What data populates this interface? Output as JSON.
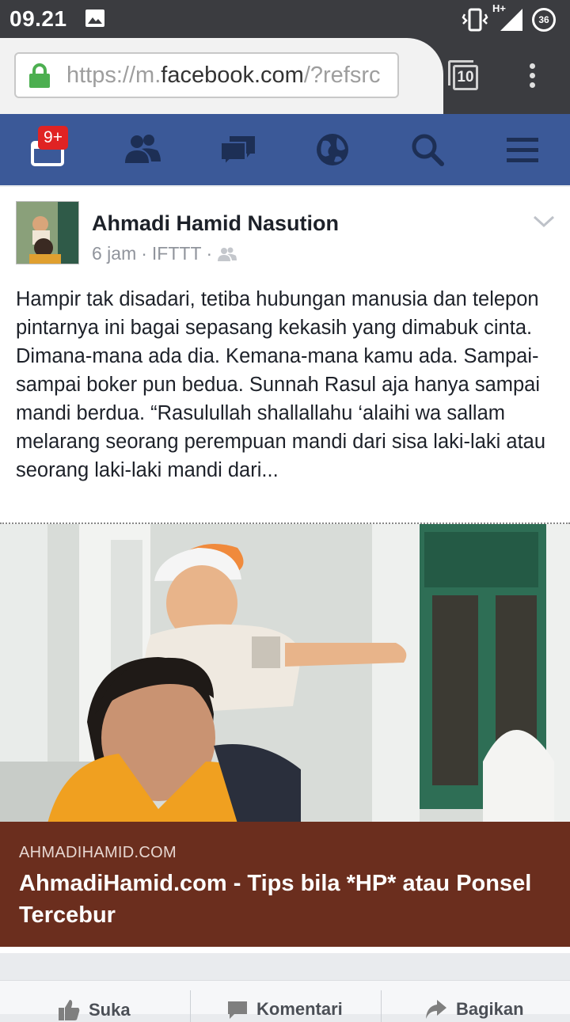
{
  "status_bar": {
    "time": "09.21",
    "network": "H+",
    "battery_level": "36",
    "icons": [
      "photo-icon",
      "vibrate-icon",
      "signal-icon",
      "battery-icon"
    ]
  },
  "browser": {
    "url_prefix": "https://m.",
    "url_host": "facebook.com",
    "url_suffix": "/?refsrc",
    "tab_count": "10",
    "icons": [
      "lock-icon",
      "tabs-icon",
      "overflow-menu-icon"
    ]
  },
  "fb_nav": {
    "notification_badge": "9+",
    "icons": [
      "feed-icon",
      "friends-icon",
      "messages-icon",
      "globe-icon",
      "search-icon",
      "menu-icon"
    ],
    "background": "#3b5998"
  },
  "post": {
    "author": "Ahmadi Hamid Nasution",
    "time": "6 jam",
    "sep1": "·",
    "app": "IFTTT",
    "sep2": "·",
    "body": "Hampir tak disadari, tetiba hubungan manusia dan telepon pintarnya ini bagai sepasang kekasih yang dimabuk cinta. Dimana-mana ada dia. Kemana-mana kamu ada. Sampai-sampai boker pun bedua. Sunnah Rasul aja hanya sampai mandi berdua. “Rasulullah shallallahu ‘alaihi wa sallam melarang seorang perempuan mandi dari sisa laki-laki atau seorang laki-laki mandi dari...",
    "link": {
      "domain": "AHMADIHAMID.COM",
      "title": "AhmadiHamid.com - Tips bila *HP* atau Ponsel Tercebur",
      "caption_color": "#6b2e1e"
    }
  },
  "actions": {
    "like": "Suka",
    "comment": "Komentari",
    "share": "Bagikan"
  }
}
